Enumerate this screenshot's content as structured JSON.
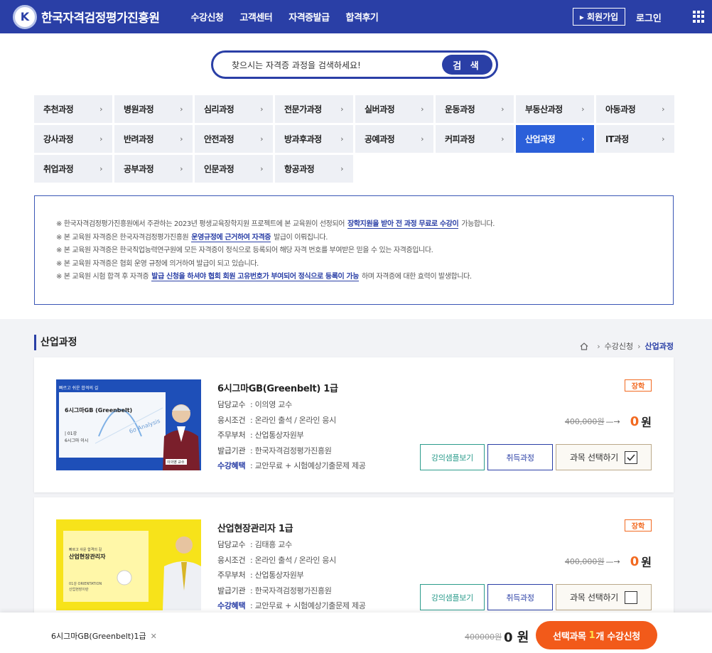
{
  "header": {
    "logo_letter": "K",
    "site_name": "한국자격검정평가진흥원",
    "nav": [
      "수강신청",
      "고객센터",
      "자격증발급",
      "합격후기"
    ],
    "join": "▸ 회원가입",
    "login": "로그인"
  },
  "search": {
    "placeholder": "찾으시는 자격증 과정을 검색하세요!",
    "button": "검 색"
  },
  "categories": [
    "추천과정",
    "병원과정",
    "심리과정",
    "전문가과정",
    "실버과정",
    "운동과정",
    "부동산과정",
    "아동과정",
    "강사과정",
    "반려과정",
    "안전과정",
    "방과후과정",
    "공예과정",
    "커피과정",
    "산업과정",
    "IT과정",
    "취업과정",
    "공부과정",
    "인문과정",
    "항공과정"
  ],
  "active_category": "산업과정",
  "notice": [
    {
      "pre": "※ 한국자격검정평가진흥원에서 주관하는 2023년 평생교육장학지원 프로젝트에 본 교육원이 선정되어",
      "hl": "장학지원을 받아 전 과정 무료로 수강이",
      "post": "가능합니다."
    },
    {
      "pre": "※ 본 교육원 자격증은 한국자격검정평가진흥원",
      "hl": "운영규정에 근거하여 자격증",
      "post": "발급이 이뤄집니다."
    },
    {
      "pre": "※ 본 교육원 자격증은 한국직업능력연구원에 모든 자격증이 정식으로 등록되어 해당 자격 번호를 부여받은 믿을 수 있는 자격증입니다.",
      "hl": "",
      "post": ""
    },
    {
      "pre": "※ 본 교육원 자격증은 협회 운영 규정에 의거하여 발급이 되고 있습니다.",
      "hl": "",
      "post": ""
    },
    {
      "pre": "※ 본 교육원 시험 합격 후 자격증",
      "hl": "발급 신청을 하셔야 협회 회원 고유번호가 부여되어 정식으로 등록이 가능",
      "post": "하며 자격증에 대한 효력이 발생합니다."
    }
  ],
  "section": {
    "title": "산업과정",
    "crumb_1": "수강신청",
    "crumb_2": "산업과정"
  },
  "labels": {
    "prof": "담당교수",
    "cond": "응시조건",
    "dept": "주무부처",
    "issuer": "발급기관",
    "benefit": "수강혜택",
    "sample": "강의샘플보기",
    "job": "취득과정",
    "select": "과목 선택하기",
    "badge": "장학",
    "won": "원"
  },
  "courses": [
    {
      "title": "6시그마GB(Greenbelt) 1급",
      "prof": ": 이의영 교수",
      "cond": ": 온라인 출석 / 온라인 응시",
      "dept": ": 산업통상자원부",
      "issuer": ": 한국자격검정평가진흥원",
      "benefit": ": 교안무료 + 시험예상기출문제 제공",
      "old_price": "400,000원",
      "new_price": "0",
      "checked": true,
      "thumb": {
        "tag": "빠르고 쉬운 합격의 길",
        "name": "6시그마GB (Greenbelt)",
        "sub": "| 01강",
        "sub2": "6시그마 이시",
        "chart": "6σ Analysis",
        "prof": "이의영 교수"
      }
    },
    {
      "title": "산업현장관리자 1급",
      "prof": ": 김태흥 교수",
      "cond": ": 온라인 출석 / 온라인 응시",
      "dept": ": 산업통상자원부",
      "issuer": ": 한국자격검정평가진흥원",
      "benefit": ": 교안무료 + 시험예상기출문제 제공",
      "old_price": "400,000원",
      "new_price": "0",
      "checked": false,
      "thumb": {
        "tag": "빠르고 쉬운 합격의 길",
        "name": "산업현장관리자",
        "sub": "01강 ORIENTATION",
        "sub2": "산업현장이란"
      }
    }
  ],
  "bottom": {
    "item": "6시그마GB(Greenbelt)1급",
    "remove": "✕",
    "old_total": "400000원",
    "total": "0 원",
    "btn_pre": "선택과목",
    "btn_count": "1",
    "btn_post": "개 수강신청"
  },
  "colors": {
    "brand": "#2a3fa6",
    "accent": "#f26a21",
    "active_tab": "#2b5fd9"
  }
}
